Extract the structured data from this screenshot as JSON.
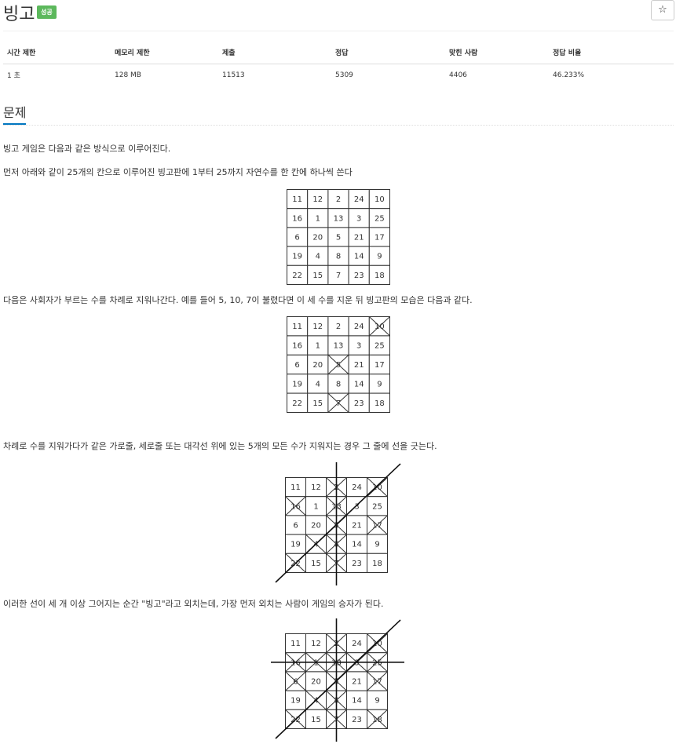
{
  "problem": {
    "title": "빙고",
    "badge": "성공",
    "star_icon": "☆"
  },
  "info_table": {
    "headers": [
      "시간 제한",
      "메모리 제한",
      "제출",
      "정답",
      "맞힌 사람",
      "정답 비율"
    ],
    "values": [
      "1 초",
      "128 MB",
      "11513",
      "5309",
      "4406",
      "46.233%"
    ]
  },
  "section_title": "문제",
  "paragraphs": [
    "빙고 게임은 다음과 같은 방식으로 이루어진다.",
    "먼저 아래와 같이 25개의 칸으로 이루어진 빙고판에 1부터 25까지 자연수를 한 칸에 하나씩 쓴다",
    "다음은 사회자가 부르는 수를 차례로 지워나간다. 예를 들어 5, 10, 7이 불렸다면 이 세 수를 지운 뒤 빙고판의 모습은 다음과 같다.",
    "차례로 수를 지워가다가 같은 가로줄, 세로줄 또는 대각선 위에 있는 5개의 모든 수가 지워지는 경우 그 줄에 선을 긋는다.",
    "이러한 선이 세 개 이상 그어지는 순간 \"빙고\"라고 외치는데, 가장 먼저 외치는 사람이 게임의 승자가 된다."
  ],
  "bingo_board": [
    [
      "11",
      "12",
      "2",
      "24",
      "10"
    ],
    [
      "16",
      "1",
      "13",
      "3",
      "25"
    ],
    [
      "6",
      "20",
      "5",
      "21",
      "17"
    ],
    [
      "19",
      "4",
      "8",
      "14",
      "9"
    ],
    [
      "22",
      "15",
      "7",
      "23",
      "18"
    ]
  ],
  "figures": [
    {
      "crossed": [],
      "lines": []
    },
    {
      "crossed": [
        "5",
        "10",
        "7"
      ],
      "lines": []
    },
    {
      "crossed": [
        "2",
        "10",
        "16",
        "13",
        "5",
        "17",
        "4",
        "8",
        "22",
        "7"
      ],
      "lines": [
        "col-3",
        "anti-diagonal"
      ]
    },
    {
      "crossed": [
        "2",
        "10",
        "16",
        "1",
        "13",
        "3",
        "25",
        "6",
        "5",
        "17",
        "4",
        "8",
        "22",
        "7",
        "18"
      ],
      "lines": [
        "row-2",
        "col-3",
        "anti-diagonal"
      ]
    }
  ]
}
